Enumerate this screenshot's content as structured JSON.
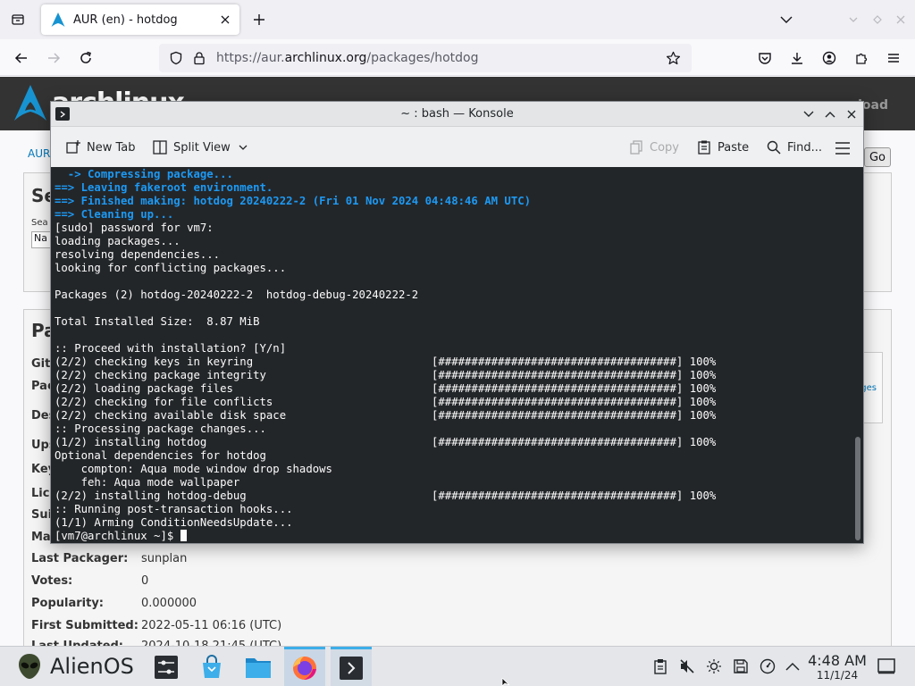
{
  "browser": {
    "tab": {
      "title": "AUR (en) - hotdog"
    },
    "url": {
      "prefix": "https://aur.",
      "domain": "archlinux.org",
      "path": "/packages/hotdog"
    }
  },
  "aur_page": {
    "logo_text": "archlinux",
    "nav_right_fragment": "load",
    "breadcrumb_fragment": "AUR",
    "go_button": "Go",
    "search_box_heading_fragment": "Se",
    "search_by_fragment": "Sea",
    "search_select_fragment": "Na",
    "details_heading_fragment": "Pa",
    "side_link_fragment": "ges",
    "left_label_fragments": [
      "Git",
      "Pac",
      "Des",
      "Ups",
      "Key",
      "Lice",
      "Sui",
      "Ma"
    ],
    "details": [
      {
        "label": "Last Packager:",
        "value": "sunplan"
      },
      {
        "label": "Votes:",
        "value": "0"
      },
      {
        "label": "Popularity:",
        "value": "0.000000"
      },
      {
        "label": "First Submitted:",
        "value": "2022-05-11 06:16 (UTC)"
      },
      {
        "label": "Last Updated:",
        "value": "2024-10-18 21:45 (UTC)"
      }
    ]
  },
  "konsole": {
    "title": "~ : bash — Konsole",
    "toolbar": {
      "new_tab": "New Tab",
      "split_view": "Split View",
      "copy": "Copy",
      "paste": "Paste",
      "find": "Find..."
    },
    "terminal_lines": [
      {
        "text": "  -> Compressing package...",
        "style": "blue"
      },
      {
        "text": "==> Leaving fakeroot environment.",
        "style": "blue"
      },
      {
        "text": "==> Finished making: hotdog 20240222-2 (Fri 01 Nov 2024 04:48:46 AM UTC)",
        "style": "blue"
      },
      {
        "text": "==> Cleaning up...",
        "style": "blue"
      },
      {
        "text": "[sudo] password for vm7:",
        "style": ""
      },
      {
        "text": "loading packages...",
        "style": ""
      },
      {
        "text": "resolving dependencies...",
        "style": ""
      },
      {
        "text": "looking for conflicting packages...",
        "style": ""
      },
      {
        "text": "",
        "style": ""
      },
      {
        "text": "Packages (2) hotdog-20240222-2  hotdog-debug-20240222-2",
        "style": ""
      },
      {
        "text": "",
        "style": ""
      },
      {
        "text": "Total Installed Size:  8.87 MiB",
        "style": ""
      },
      {
        "text": "",
        "style": ""
      },
      {
        "text": ":: Proceed with installation? [Y/n]",
        "style": ""
      },
      {
        "text": "(2/2) checking keys in keyring                           [####################################] 100%",
        "style": ""
      },
      {
        "text": "(2/2) checking package integrity                         [####################################] 100%",
        "style": ""
      },
      {
        "text": "(2/2) loading package files                              [####################################] 100%",
        "style": ""
      },
      {
        "text": "(2/2) checking for file conflicts                        [####################################] 100%",
        "style": ""
      },
      {
        "text": "(2/2) checking available disk space                      [####################################] 100%",
        "style": ""
      },
      {
        "text": ":: Processing package changes...",
        "style": ""
      },
      {
        "text": "(1/2) installing hotdog                                  [####################################] 100%",
        "style": ""
      },
      {
        "text": "Optional dependencies for hotdog",
        "style": ""
      },
      {
        "text": "    compton: Aqua mode window drop shadows",
        "style": ""
      },
      {
        "text": "    feh: Aqua mode wallpaper",
        "style": ""
      },
      {
        "text": "(2/2) installing hotdog-debug                            [####################################] 100%",
        "style": ""
      },
      {
        "text": ":: Running post-transaction hooks...",
        "style": ""
      },
      {
        "text": "(1/1) Arming ConditionNeedsUpdate...",
        "style": ""
      }
    ],
    "prompt": "[vm7@archlinux ~]$ "
  },
  "taskbar": {
    "launcher_name": "AlienOS",
    "clock_time": "4:48 AM",
    "clock_date": "11/1/24"
  },
  "colors": {
    "terminal_bg": "#232629",
    "terminal_fg": "#fcfcfc",
    "terminal_blue": "#1d99f3",
    "aur_header": "#333333",
    "accent": "#3daee9"
  }
}
